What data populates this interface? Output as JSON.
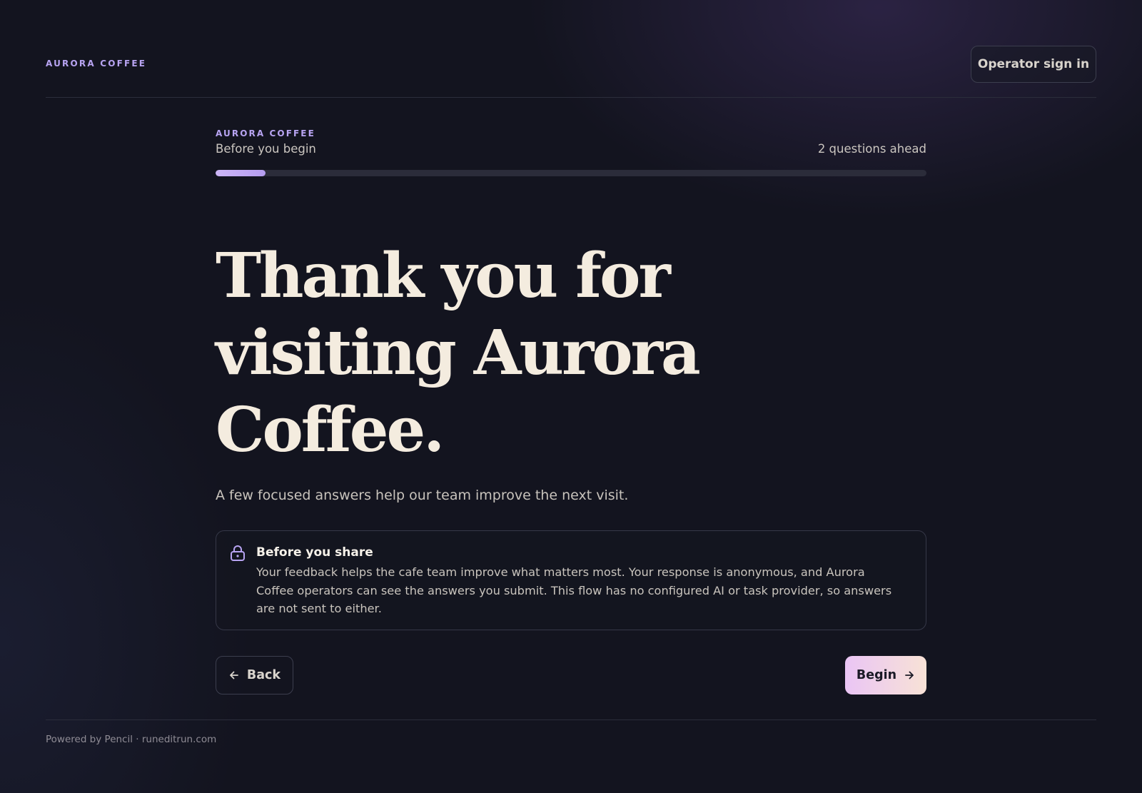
{
  "header": {
    "brand": "AURORA COFFEE",
    "signin_label": "Operator sign in"
  },
  "progress": {
    "eyebrow": "AURORA COFFEE",
    "step_label": "Before you begin",
    "remaining": "2 questions ahead",
    "fraction": 0.07
  },
  "hero": {
    "headline": "Thank you for visiting Aurora Coffee.",
    "subtitle": "A few focused answers help our team improve the next visit."
  },
  "notice": {
    "icon": "lock-icon",
    "title": "Before you share",
    "body": "Your feedback helps the cafe team improve what matters most. Your response is anonymous, and Aurora Coffee operators can see the answers you submit. This flow has no configured AI or task provider, so answers are not sent to either."
  },
  "actions": {
    "back_label": "Back",
    "begin_label": "Begin"
  },
  "footer": {
    "text": "Powered by Pencil · runeditrun.com"
  },
  "colors": {
    "accent": "#b8a4f2",
    "background": "#13141f",
    "headline": "#f4ecdf",
    "begin_gradient_start": "#eac5f5",
    "begin_gradient_end": "#f8e2d6"
  }
}
